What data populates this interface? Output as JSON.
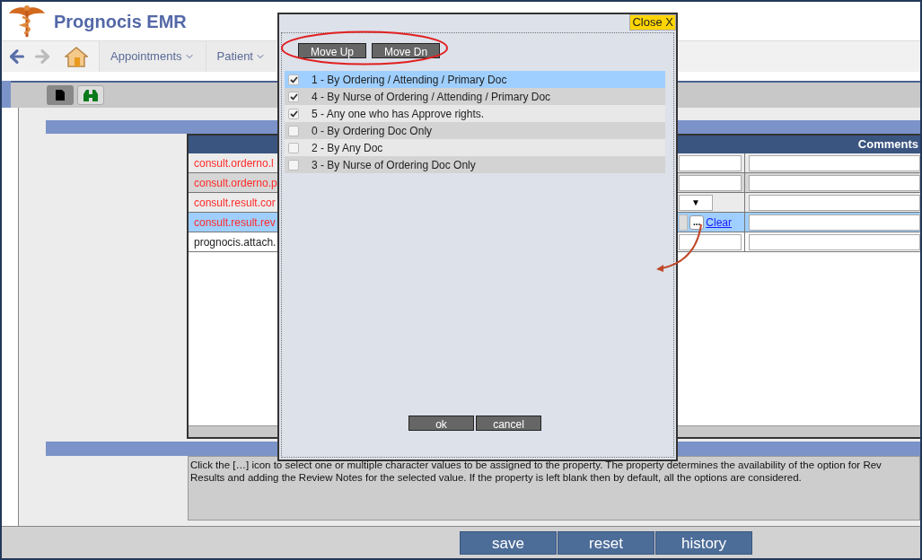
{
  "app": {
    "title": "Prognocis EMR"
  },
  "nav": {
    "menus": [
      {
        "label": "Appointments"
      },
      {
        "label": "Patient"
      }
    ]
  },
  "table": {
    "header": "Comments",
    "rows": [
      {
        "property": "consult.orderno.l",
        "required": true,
        "selected": false,
        "kind": "text"
      },
      {
        "property": "consult.orderno.p",
        "required": true,
        "selected": false,
        "kind": "text"
      },
      {
        "property": "consult.result.cor",
        "required": true,
        "selected": false,
        "kind": "select",
        "caret": "▼"
      },
      {
        "property": "consult.result.rev",
        "required": true,
        "selected": true,
        "kind": "lookup",
        "lookup": "...",
        "clear": "Clear"
      },
      {
        "property": "prognocis.attach.",
        "required": false,
        "selected": false,
        "kind": "text"
      }
    ]
  },
  "description": [
    "Click the […] icon to select one or multiple character values to be assigned to the property. The property determines the availability of the option for Rev",
    "Results and adding the Review Notes for the selected value. If the property is left blank then by default, all the options are considered."
  ],
  "footer_buttons": [
    "save",
    "reset",
    "history"
  ],
  "dialog": {
    "close": "Close X",
    "buttons": [
      "Move Up",
      "Move Dn"
    ],
    "options": [
      {
        "label": "1 - By Ordering / Attending / Primary Doc",
        "checked": true,
        "selected": true
      },
      {
        "label": "4 - By Nurse of Ordering / Attending / Primary Doc",
        "checked": true,
        "selected": false
      },
      {
        "label": "5 - Any one who has Approve rights.",
        "checked": true,
        "selected": false
      },
      {
        "label": "0 - By Ordering Doc Only",
        "checked": false,
        "selected": false
      },
      {
        "label": "2 - By Any Doc",
        "checked": false,
        "selected": false
      },
      {
        "label": "3 - By Nurse of Ordering Doc Only",
        "checked": false,
        "selected": false
      }
    ],
    "actions": [
      "ok",
      "cancel"
    ]
  }
}
